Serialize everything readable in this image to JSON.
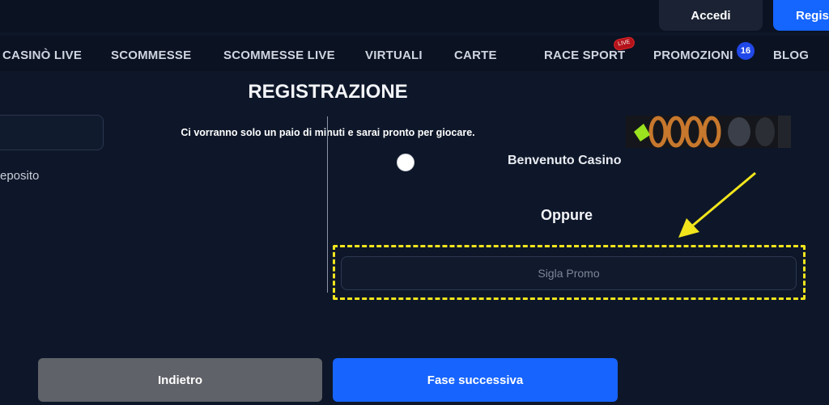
{
  "header": {
    "login_label": "Accedi",
    "register_label": "Regis"
  },
  "nav": {
    "items": [
      "CASINÒ LIVE",
      "SCOMMESSE",
      "SCOMMESSE LIVE",
      "VIRTUALI",
      "CARTE",
      "RACE SPORT",
      "PROMOZIONI",
      "BLOG"
    ],
    "race_sport_badge": "LIVE",
    "promotions_count": "16"
  },
  "form": {
    "title": "REGISTRAZIONE",
    "subtitle": "Ci vorranno solo un paio di minuti e sarai pronto per giocare.",
    "left_partial_text": "eposito",
    "bonus_option_label": "Benvenuto Casino",
    "or_label": "Oppure",
    "promo_placeholder": "Sigla Promo",
    "promo_value": ""
  },
  "actions": {
    "back_label": "Indietro",
    "next_label": "Fase successiva"
  },
  "colors": {
    "background": "#0e1729",
    "accent": "#1764ff",
    "highlight": "#f2e51c",
    "badge": "#2148e8"
  }
}
